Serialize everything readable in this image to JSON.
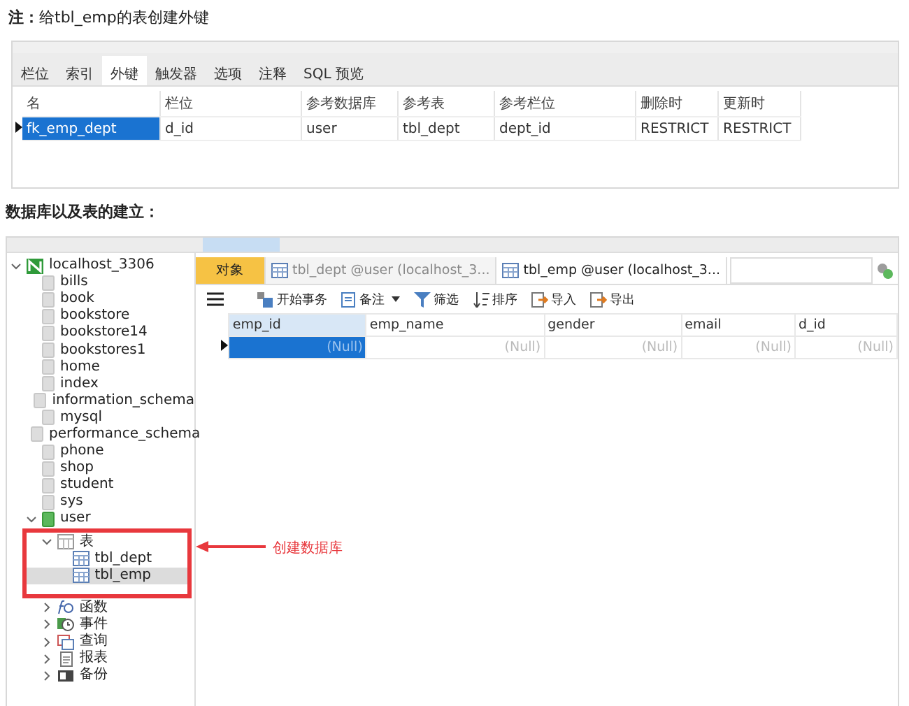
{
  "note": "**注：**给tbl_emp的表创建外键",
  "fk_panel": {
    "tabs": [
      {
        "label": "栏位",
        "selected": false
      },
      {
        "label": "索引",
        "selected": false
      },
      {
        "label": "外键",
        "selected": true
      },
      {
        "label": "触发器",
        "selected": false
      },
      {
        "label": "选项",
        "selected": false
      },
      {
        "label": "注释",
        "selected": false
      },
      {
        "label": "SQL 预览",
        "selected": false
      }
    ],
    "columns": [
      "名",
      "栏位",
      "参考数据库",
      "参考表",
      "参考栏位",
      "删除时",
      "更新时"
    ],
    "rows": [
      {
        "cells": [
          "fk_emp_dept",
          "d_id",
          "user",
          "tbl_dept",
          "dept_id",
          "RESTRICT",
          "RESTRICT"
        ],
        "selected": true
      }
    ]
  },
  "heading": "数据库以及表的建立：",
  "navicat": {
    "tree": [
      {
        "label": "localhost_3306",
        "kind": "server",
        "expanded": true,
        "selected": false,
        "children": [
          {
            "label": "bills",
            "kind": "db",
            "selected": false
          },
          {
            "label": "book",
            "kind": "db",
            "selected": false
          },
          {
            "label": "bookstore",
            "kind": "db",
            "selected": false
          },
          {
            "label": "bookstore14",
            "kind": "db",
            "selected": false
          },
          {
            "label": "bookstores1",
            "kind": "db",
            "selected": false
          },
          {
            "label": "home",
            "kind": "db",
            "selected": false
          },
          {
            "label": "index",
            "kind": "db",
            "selected": false
          },
          {
            "label": "information_schema",
            "kind": "db",
            "selected": false
          },
          {
            "label": "mysql",
            "kind": "db",
            "selected": false
          },
          {
            "label": "performance_schema",
            "kind": "db",
            "selected": false
          },
          {
            "label": "phone",
            "kind": "db",
            "selected": false
          },
          {
            "label": "shop",
            "kind": "db",
            "selected": false
          },
          {
            "label": "student",
            "kind": "db",
            "selected": false
          },
          {
            "label": "sys",
            "kind": "db",
            "selected": false
          },
          {
            "label": "user",
            "kind": "db-open",
            "expanded": true,
            "selected": false,
            "children": [
              {
                "label": "表",
                "kind": "tables",
                "expanded": true,
                "selected": false,
                "highlighted": true,
                "children": [
                  {
                    "label": "tbl_dept",
                    "kind": "table",
                    "selected": false
                  },
                  {
                    "label": "tbl_emp",
                    "kind": "table",
                    "selected": true
                  }
                ]
              },
              {
                "label": "函数",
                "kind": "functions",
                "expanded": false,
                "selected": false,
                "highlighted": false
              },
              {
                "label": "事件",
                "kind": "events",
                "expanded": false,
                "selected": false,
                "highlighted": false
              },
              {
                "label": "查询",
                "kind": "queries",
                "expanded": false,
                "selected": false,
                "highlighted": false
              },
              {
                "label": "报表",
                "kind": "reports",
                "expanded": false,
                "selected": false,
                "highlighted": false
              },
              {
                "label": "备份",
                "kind": "backups",
                "expanded": false,
                "selected": false,
                "highlighted": false
              }
            ]
          }
        ]
      }
    ],
    "tabs": [
      {
        "label": "对象",
        "kind": "object",
        "selected": false
      },
      {
        "label": "tbl_dept @user (localhost_3...",
        "kind": "table",
        "selected": false
      },
      {
        "label": "tbl_emp @user (localhost_3...",
        "kind": "table",
        "selected": true
      }
    ],
    "toolbar": [
      {
        "kind": "menu"
      },
      {
        "label": "开始事务",
        "kind": "begin"
      },
      {
        "label": "备注",
        "kind": "note"
      },
      {
        "label": "筛选",
        "kind": "filter"
      },
      {
        "label": "排序",
        "kind": "sort"
      },
      {
        "label": "导入",
        "kind": "import"
      },
      {
        "label": "导出",
        "kind": "export"
      }
    ],
    "grid": {
      "columns": [
        "emp_id",
        "emp_name",
        "gender",
        "email",
        "d_id"
      ],
      "rows": [
        {
          "cells": [
            "(Null)",
            "(Null)",
            "(Null)",
            "(Null)",
            "(Null)"
          ],
          "selected": true
        }
      ]
    }
  },
  "annotation": "创建数据库"
}
